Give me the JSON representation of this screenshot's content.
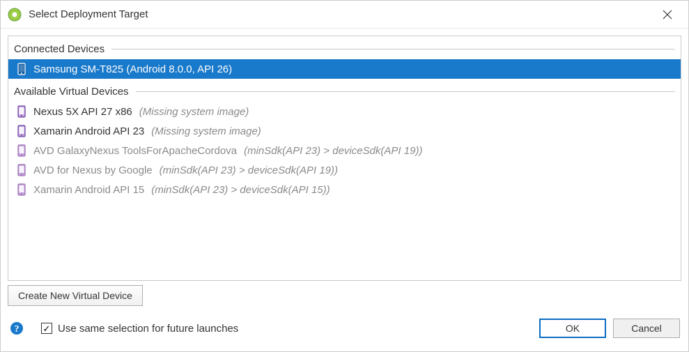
{
  "window": {
    "title": "Select Deployment Target"
  },
  "sections": {
    "connected_label": "Connected Devices",
    "available_label": "Available Virtual Devices"
  },
  "connected": [
    {
      "name": "Samsung SM-T825 (Android 8.0.0, API 26)",
      "note": "",
      "selected": true,
      "dimmed": false
    }
  ],
  "available": [
    {
      "name": "Nexus 5X API 27 x86",
      "note": "(Missing system image)",
      "dimmed": false
    },
    {
      "name": "Xamarin Android API 23",
      "note": "(Missing system image)",
      "dimmed": false
    },
    {
      "name": "AVD GalaxyNexus ToolsForApacheCordova",
      "note": "(minSdk(API 23) > deviceSdk(API 19))",
      "dimmed": true
    },
    {
      "name": "AVD for Nexus by Google",
      "note": "(minSdk(API 23) > deviceSdk(API 19))",
      "dimmed": true
    },
    {
      "name": "Xamarin Android API 15",
      "note": "(minSdk(API 23) > deviceSdk(API 15))",
      "dimmed": true
    }
  ],
  "buttons": {
    "create": "Create New Virtual Device",
    "ok": "OK",
    "cancel": "Cancel"
  },
  "checkbox": {
    "label": "Use same selection for future launches",
    "checked": true
  }
}
